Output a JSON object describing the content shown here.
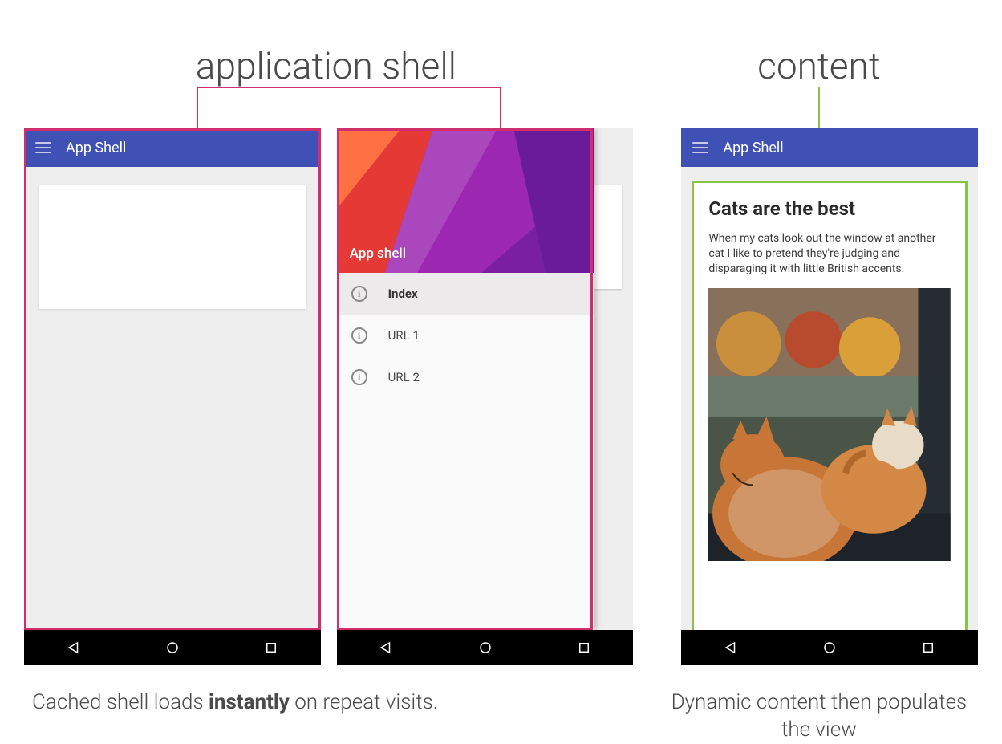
{
  "labels": {
    "application_shell": "application shell",
    "content": "content"
  },
  "appbar": {
    "title": "App Shell"
  },
  "drawer": {
    "header_label": "App shell",
    "items": [
      {
        "label": "Index",
        "active": true
      },
      {
        "label": "URL 1",
        "active": false
      },
      {
        "label": "URL 2",
        "active": false
      }
    ]
  },
  "content_card": {
    "title": "Cats are the best",
    "body": "When my cats look out the window at another cat I like to pretend they're judging and disparaging it with little British accents."
  },
  "captions": {
    "shell_pre": "Cached shell loads ",
    "shell_strong": "instantly",
    "shell_post": " on repeat visits.",
    "content": "Dynamic content then populates the view"
  },
  "colors": {
    "pink": "#d12e6e",
    "green": "#8bc34a",
    "indigo": "#3f51b5"
  }
}
